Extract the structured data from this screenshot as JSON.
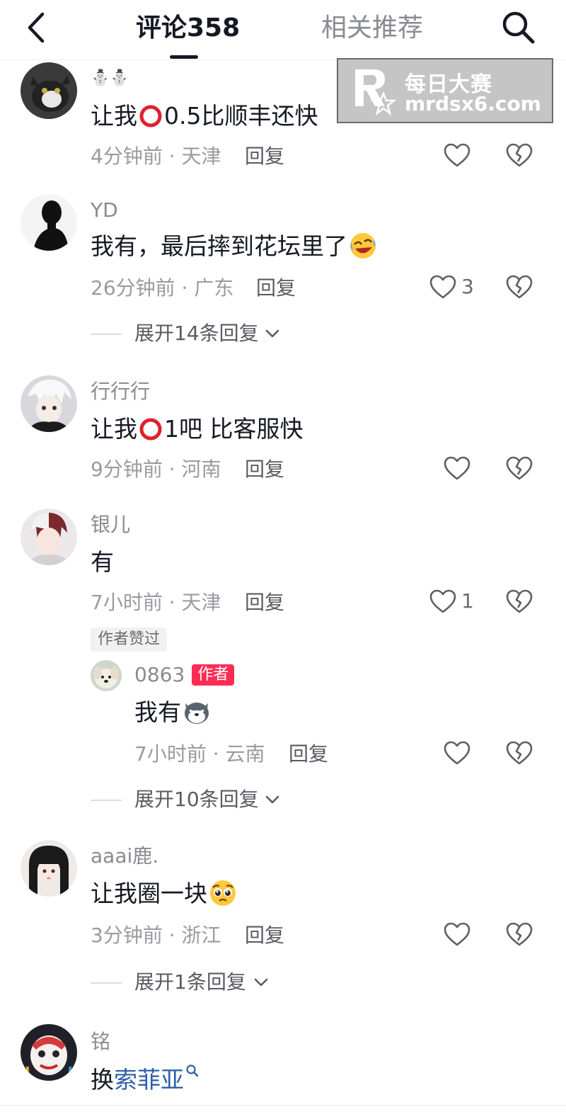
{
  "header": {
    "tab_comments": "评论358",
    "tab_related": "相关推荐"
  },
  "watermark": {
    "title": "每日大赛",
    "url": "mrdsx6.com"
  },
  "colors": {
    "author_badge": "#fe2c55",
    "search_link": "#2f5fa5",
    "secondary_text": "#8a8b91"
  },
  "comments": [
    {
      "username": "⛄⛄",
      "text_before": "让我",
      "emoji": "red-ring",
      "text_after": "0.5比顺丰还快",
      "meta": "4分钟前 · 天津",
      "reply": "回复",
      "likes": ""
    },
    {
      "username": "YD",
      "text": "我有，最后摔到花坛里了",
      "emoji": "rolling-laugh-face",
      "meta": "26分钟前 · 广东",
      "reply": "回复",
      "likes": "3",
      "expand": "展开14条回复"
    },
    {
      "username": "行行行",
      "text_before": "让我",
      "emoji": "red-ring",
      "text_after": "1吧 比客服快",
      "meta": "9分钟前 · 河南",
      "reply": "回复",
      "likes": ""
    },
    {
      "username": "银儿",
      "text": "有",
      "meta": "7小时前 · 天津",
      "reply": "回复",
      "likes": "1",
      "tag": "作者赞过",
      "sub_reply": {
        "username": "0863",
        "badge": "作者",
        "text": "我有",
        "emoji": "husky-face",
        "meta": "7小时前 · 云南",
        "reply": "回复"
      },
      "expand": "展开10条回复"
    },
    {
      "username": "aaai鹿.",
      "text": "让我圈一块",
      "emoji": "pleading-face",
      "meta": "3分钟前 · 浙江",
      "reply": "回复",
      "likes": "",
      "expand": "展开1条回复"
    },
    {
      "username": "铭",
      "text_before": "换",
      "link": "索菲亚"
    }
  ]
}
